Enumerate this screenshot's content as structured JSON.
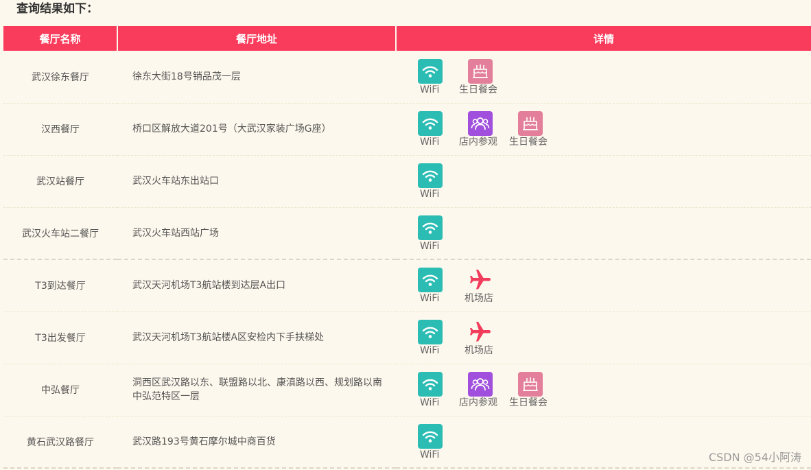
{
  "page": {
    "title": "查询结果如下："
  },
  "table": {
    "headers": [
      "餐厅名称",
      "餐厅地址",
      "详情"
    ],
    "rows": [
      {
        "name": "武汉徐东餐厅",
        "address": "徐东大街18号销品茂一层",
        "features": [
          "wifi",
          "birthday"
        ]
      },
      {
        "name": "汉西餐厅",
        "address": "桥口区解放大道201号（大武汉家装广场G座）",
        "features": [
          "wifi",
          "tour",
          "birthday"
        ]
      },
      {
        "name": "武汉站餐厅",
        "address": "武汉火车站东出站口",
        "features": [
          "wifi"
        ]
      },
      {
        "name": "武汉火车站二餐厅",
        "address": "武汉火车站西站广场",
        "features": [
          "wifi"
        ]
      },
      {
        "name": "T3到达餐厅",
        "address": "武汉天河机场T3航站楼到达层A出口",
        "features": [
          "wifi",
          "airport"
        ]
      },
      {
        "name": "T3出发餐厅",
        "address": "武汉天河机场T3航站楼A区安检内下手扶梯处",
        "features": [
          "wifi",
          "airport"
        ]
      },
      {
        "name": "中弘餐厅",
        "address": "洞西区武汉路以东、联盟路以北、康滇路以西、规划路以南中弘范特区一层",
        "features": [
          "wifi",
          "tour",
          "birthday"
        ]
      },
      {
        "name": "黄石武汉路餐厅",
        "address": "武汉路193号黄石摩尔城中商百货",
        "features": [
          "wifi"
        ]
      }
    ]
  },
  "feature_types": {
    "wifi": {
      "label": "WiFi",
      "icon": "wifi-icon",
      "color": "#2bbdb4"
    },
    "tour": {
      "label": "店内参观",
      "icon": "group-icon",
      "color": "#a050dc"
    },
    "birthday": {
      "label": "生日餐会",
      "icon": "cake-icon",
      "color": "#e37f9a"
    },
    "airport": {
      "label": "机场店",
      "icon": "airplane-icon",
      "color": "#f23c5c"
    }
  },
  "colors": {
    "header_bg": "#fa3c5c",
    "page_bg": "#fdf8ed"
  },
  "watermark": "CSDN @54小阿涛"
}
